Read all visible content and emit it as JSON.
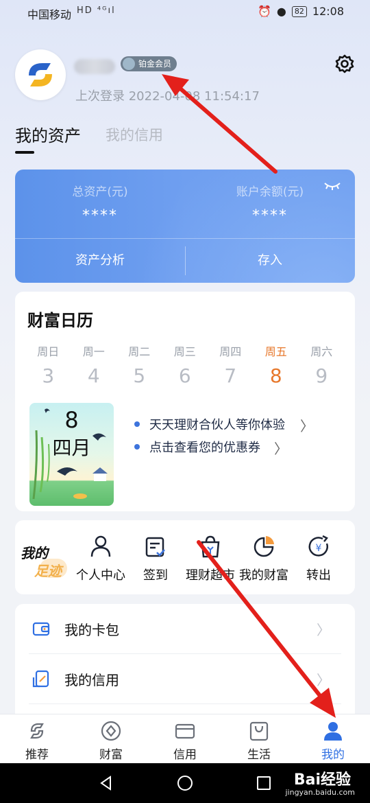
{
  "status_bar": {
    "carrier": "中国移动",
    "signal_icons": "HD ⁴ᴳıl",
    "battery": "82",
    "time": "12:08"
  },
  "profile": {
    "member_badge": "铂金会员",
    "last_login": "上次登录 2022-04-08 11:54:17"
  },
  "tabs": [
    {
      "label": "我的资产",
      "active": true
    },
    {
      "label": "我的信用",
      "active": false
    }
  ],
  "asset_card": {
    "total_label": "总资产(元)",
    "total_value": "****",
    "balance_label": "账户余额(元)",
    "balance_value": "****",
    "analysis_button": "资产分析",
    "deposit_button": "存入"
  },
  "calendar": {
    "title": "财富日历",
    "days": [
      {
        "weekday": "周日",
        "date": "3"
      },
      {
        "weekday": "周一",
        "date": "4"
      },
      {
        "weekday": "周二",
        "date": "5"
      },
      {
        "weekday": "周三",
        "date": "6"
      },
      {
        "weekday": "周四",
        "date": "7"
      },
      {
        "weekday": "周五",
        "date": "8",
        "active": true
      },
      {
        "weekday": "周六",
        "date": "9"
      }
    ],
    "tile_day": "8",
    "tile_month": "四月",
    "promos": [
      "天天理财合伙人等你体验",
      "点击查看您的优惠券"
    ]
  },
  "footprint": {
    "logo_line1": "我的",
    "logo_line2": "足迹",
    "items": [
      {
        "label": "个人中心",
        "icon": "person-icon"
      },
      {
        "label": "签到",
        "icon": "checkin-icon"
      },
      {
        "label": "理财超市",
        "icon": "shopping-bag-icon"
      },
      {
        "label": "我的财富",
        "icon": "pie-chart-icon"
      },
      {
        "label": "转出",
        "icon": "transfer-out-icon"
      }
    ]
  },
  "menu": [
    {
      "label": "我的卡包",
      "icon": "wallet-icon"
    },
    {
      "label": "我的信用",
      "icon": "credit-icon"
    }
  ],
  "bottom_nav": [
    {
      "label": "推荐",
      "icon": "recommend-icon"
    },
    {
      "label": "财富",
      "icon": "wealth-icon"
    },
    {
      "label": "信用",
      "icon": "credit-card-icon"
    },
    {
      "label": "生活",
      "icon": "life-icon"
    },
    {
      "label": "我的",
      "icon": "me-icon",
      "active": true
    }
  ],
  "watermark": {
    "brand": "Bai经验",
    "url": "jingyan.baidu.com"
  },
  "colors": {
    "accent_blue": "#2f6fe2",
    "card_blue": "#6a9bef",
    "highlight_orange": "#e7782c",
    "annotation_red": "#e3201b"
  }
}
